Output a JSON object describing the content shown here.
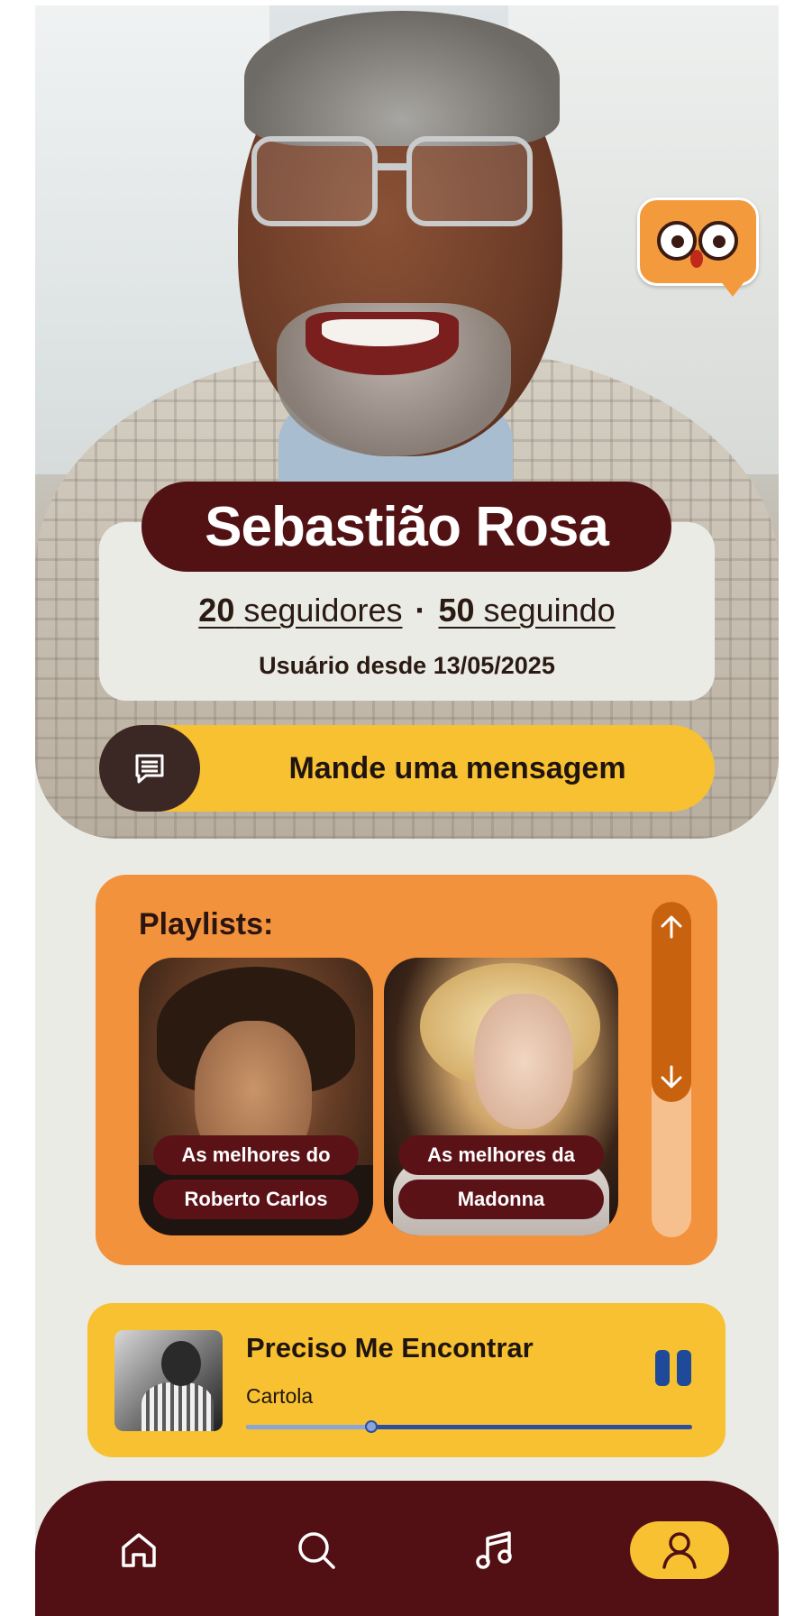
{
  "profile": {
    "name": "Sebastião Rosa",
    "followers_count": "20",
    "followers_label": "seguidores",
    "separator": "·",
    "following_count": "50",
    "following_label": "seguindo",
    "member_since": "Usuário desde 13/05/2025"
  },
  "actions": {
    "message_label": "Mande uma mensagem"
  },
  "playlists": {
    "title": "Playlists:",
    "items": [
      {
        "line1": "As melhores do",
        "line2": "Roberto Carlos"
      },
      {
        "line1": "As melhores da",
        "line2": "Madonna"
      }
    ]
  },
  "player": {
    "title": "Preciso Me Encontrar",
    "artist": "Cartola",
    "progress": 0.28,
    "state": "playing"
  },
  "nav": {
    "items": [
      "home-icon",
      "search-icon",
      "music-icon",
      "profile-icon"
    ],
    "active": "profile-icon"
  },
  "colors": {
    "maroon": "#521214",
    "yellow": "#f8c131",
    "orange": "#f3923d",
    "blue": "#2d4fa3"
  }
}
